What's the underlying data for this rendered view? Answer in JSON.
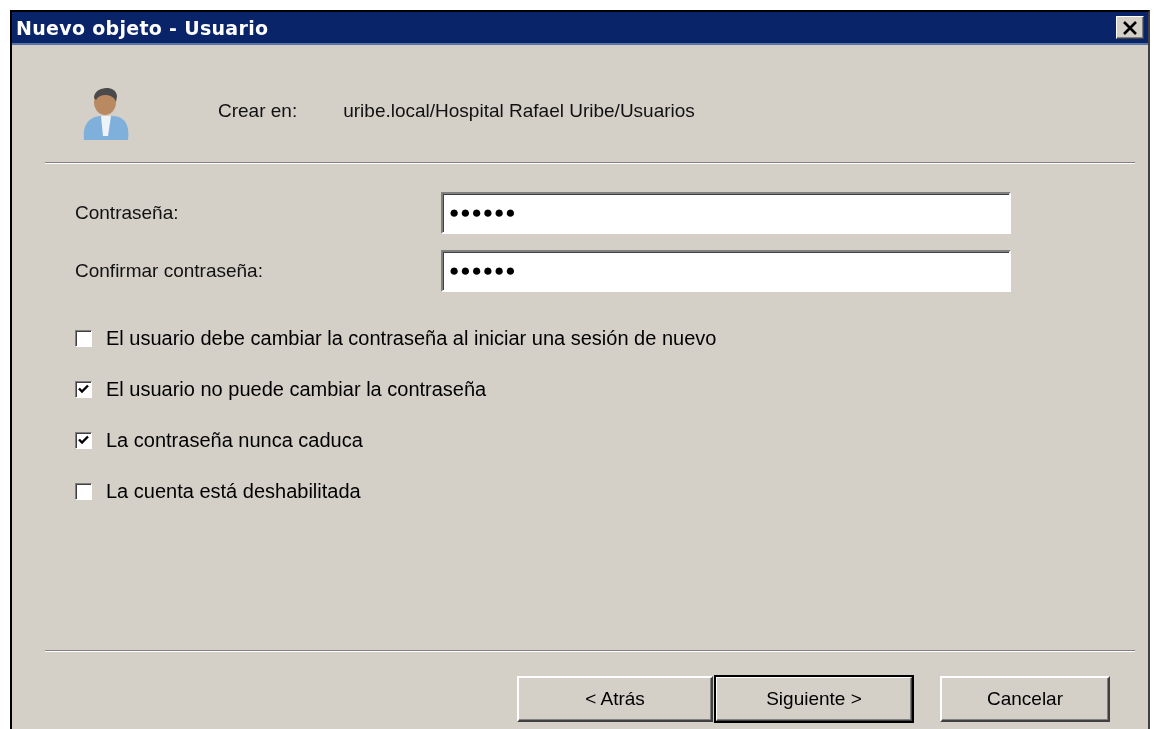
{
  "window": {
    "title": "Nuevo objeto - Usuario"
  },
  "create_in": {
    "label": "Crear en:",
    "path": "uribe.local/Hospital Rafael Uribe/Usuarios"
  },
  "fields": [
    {
      "label": "Contraseña:",
      "value": "●●●●●●"
    },
    {
      "label": "Confirmar contraseña:",
      "value": "●●●●●●"
    }
  ],
  "options": [
    {
      "label": "El usuario debe cambiar la contraseña al iniciar una sesión de nuevo",
      "checked": false
    },
    {
      "label": "El usuario no puede cambiar la contraseña",
      "checked": true
    },
    {
      "label": "La contraseña nunca caduca",
      "checked": true
    },
    {
      "label": "La cuenta está deshabilitada",
      "checked": false
    }
  ],
  "buttons": [
    {
      "label": "< Atrás",
      "default": false
    },
    {
      "label": "Siguiente >",
      "default": true
    },
    {
      "label": "Cancelar",
      "default": false
    }
  ]
}
